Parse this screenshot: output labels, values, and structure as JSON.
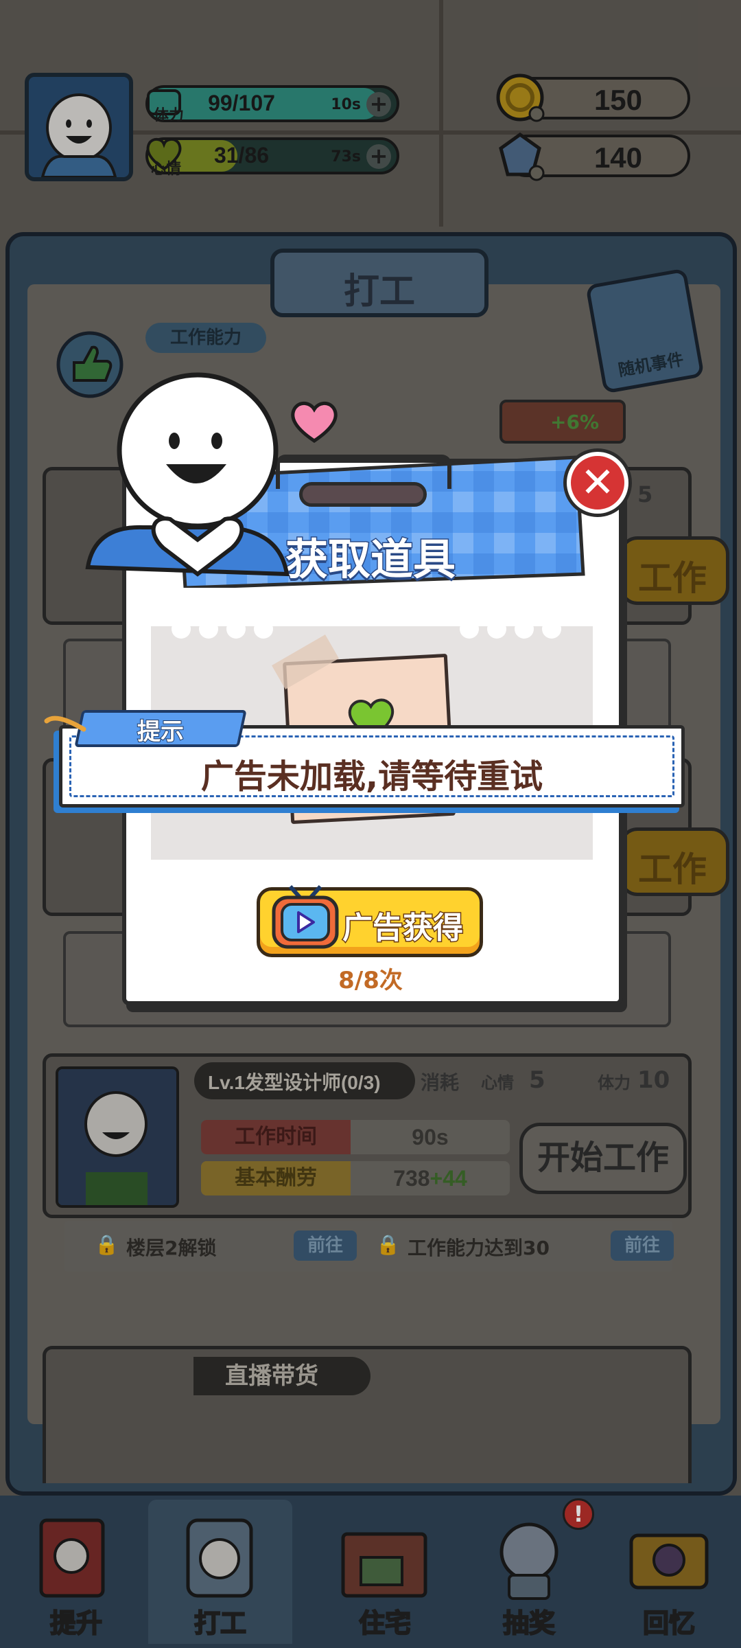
{
  "hud": {
    "stamina": {
      "label": "体力",
      "value": "99/107",
      "timer": "10s",
      "fill": 0.93
    },
    "mood": {
      "label": "心情",
      "value": "31/86",
      "timer": "73s",
      "fill": 0.36
    },
    "coins": "150",
    "gems": "140"
  },
  "work_panel": {
    "title": "打工",
    "ability_label": "工作能力",
    "random_event": "随机事件",
    "bonus": "+6%",
    "side_count": "5",
    "side_button": "工作",
    "job": {
      "title": "Lv.1发型设计师(0/3)",
      "cost_label": "消耗",
      "mood_cost_label": "心情",
      "mood_cost": "5",
      "stamina_cost_label": "体力",
      "stamina_cost": "10",
      "time_label": "工作时间",
      "time_value": "90s",
      "pay_label": "基本酬劳",
      "pay_value": "738",
      "pay_bonus": "+44",
      "start_button": "开始工作"
    },
    "unlock": {
      "req1": "楼层2解锁",
      "req2": "工作能力达到30",
      "go_label": "前往"
    },
    "live_title": "直播带货"
  },
  "modal": {
    "title": "获取道具",
    "ad_button": "广告获得",
    "ad_count": "8/8次"
  },
  "toast": {
    "tag": "提示",
    "message": "广告未加载,请等待重试"
  },
  "nav": [
    {
      "label": "提升"
    },
    {
      "label": "打工"
    },
    {
      "label": "住宅"
    },
    {
      "label": "抽奖",
      "badge": "!"
    },
    {
      "label": "回忆"
    }
  ],
  "colors": {
    "modal_blue": "#5a9df0",
    "toast_border": "#2a63b4",
    "close_red": "#d63434",
    "ad_yellow": "#ffd22e"
  }
}
